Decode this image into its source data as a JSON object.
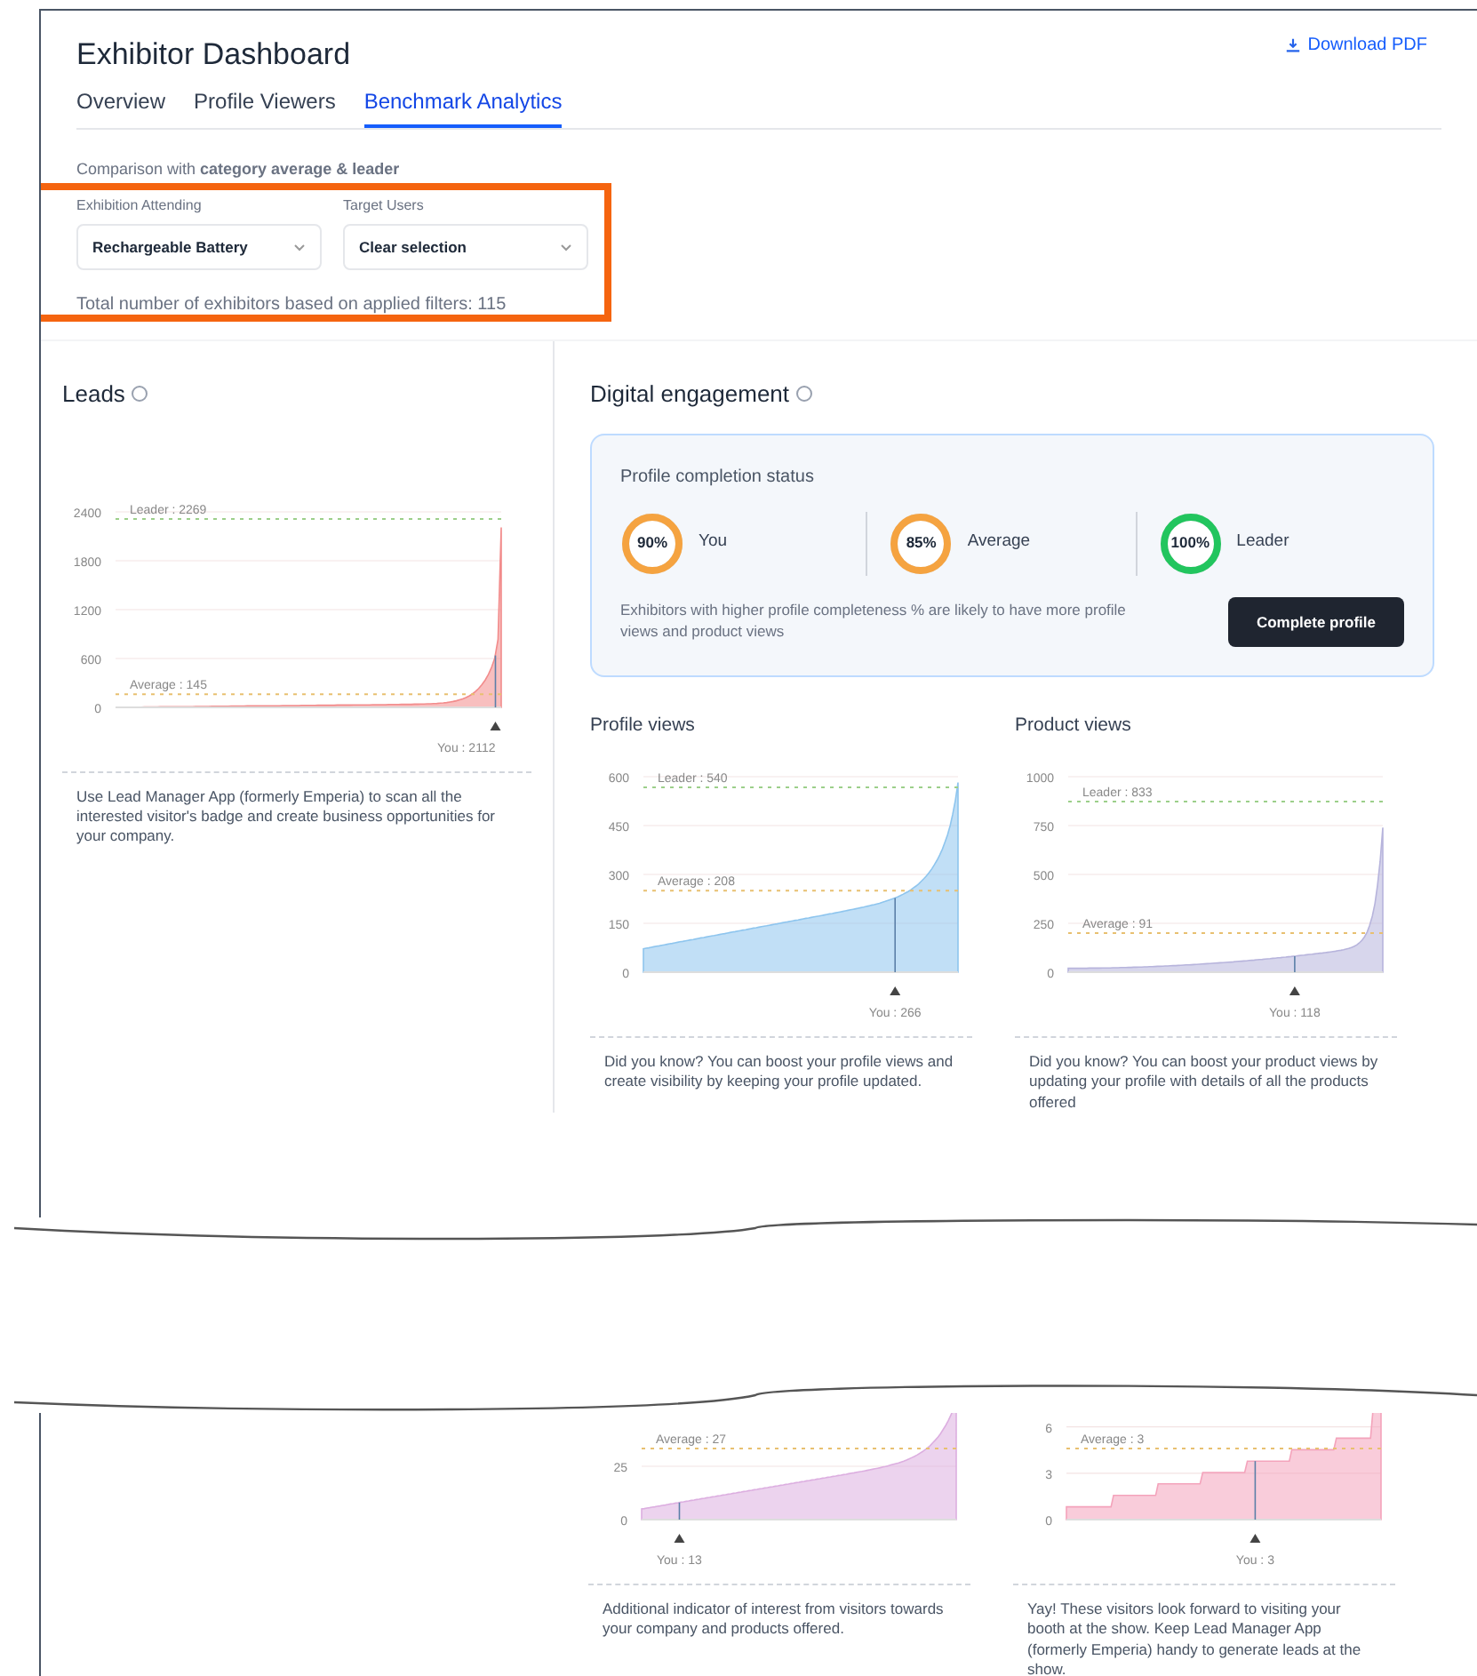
{
  "header": {
    "title": "Exhibitor Dashboard",
    "download": "Download PDF"
  },
  "tabs": [
    {
      "label": "Overview",
      "selected": false
    },
    {
      "label": "Profile Viewers",
      "selected": false
    },
    {
      "label": "Benchmark Analytics",
      "selected": true
    }
  ],
  "comparison": "Comparison with **category average & leader**",
  "filters": [
    {
      "label": "Exhibition Attending",
      "value": "Rechargeable Battery"
    },
    {
      "label": "Target Users",
      "value": "Clear selection"
    }
  ],
  "total_text": "Total number of exhibitors based on applied filters: 115",
  "leads": {
    "title": "Leads",
    "chart": {
      "kind": "steep",
      "color": "#f28b8b",
      "y_ticks": [
        "2400",
        "1800",
        "1200",
        "600",
        "0"
      ],
      "leader": "Leader : 2269",
      "average": "Average : 145",
      "you": "You : 2112"
    },
    "note": "Use Lead Manager App (formerly Emperia) to scan all the interested visitor's badge and create business opportunities for your company."
  },
  "digital": {
    "title": "Digital engagement",
    "completion": {
      "title": "Profile completion status",
      "rings": [
        {
          "value": "90%",
          "label": "You",
          "color": "#f5a340"
        },
        {
          "value": "85%",
          "label": "Average",
          "color": "#f5a340"
        },
        {
          "value": "100%",
          "label": "Leader",
          "color": "#22c55e"
        }
      ],
      "note": "Exhibitors with higher profile completeness % are likely to have more profile views and product views",
      "button": "Complete profile"
    },
    "panels": [
      {
        "title": "Profile views",
        "chart": {
          "kind": "s-curve",
          "color": "#8ec5ee",
          "y_ticks": [
            "600",
            "450",
            "300",
            "150",
            "0"
          ],
          "leader": "Leader : 540",
          "average": "Average : 208",
          "you": "You : 266"
        },
        "note": "Did you know? You can boost your profile views and create visibility by keeping your profile updated."
      },
      {
        "title": "Product views",
        "chart": {
          "kind": "steep-late",
          "color": "#b7b4dc",
          "y_ticks": [
            "1000",
            "750",
            "500",
            "250",
            "0"
          ],
          "leader": "Leader : 833",
          "average": "Average : 91",
          "you": "You : 118"
        },
        "note": "Did you know? You can boost your product views by updating your profile with details of all the products offered"
      }
    ]
  },
  "lower_panels": [
    {
      "chart": {
        "kind": "s-curve-cut",
        "color": "#dcaee0",
        "y_ticks": [
          "25",
          "0"
        ],
        "average": "Average : 27",
        "you": "You : 13"
      },
      "note": "Additional indicator of interest from visitors towards your company and products offered."
    },
    {
      "chart": {
        "kind": "steps",
        "color": "#f4a3bb",
        "y_ticks": [
          "6",
          "3",
          "0"
        ],
        "average": "Average : 3",
        "you": "You : 3"
      },
      "note": "Yay! These visitors look forward to visiting your booth at the show. Keep Lead Manager App (formerly Emperia) handy to generate leads at the show."
    }
  ]
}
